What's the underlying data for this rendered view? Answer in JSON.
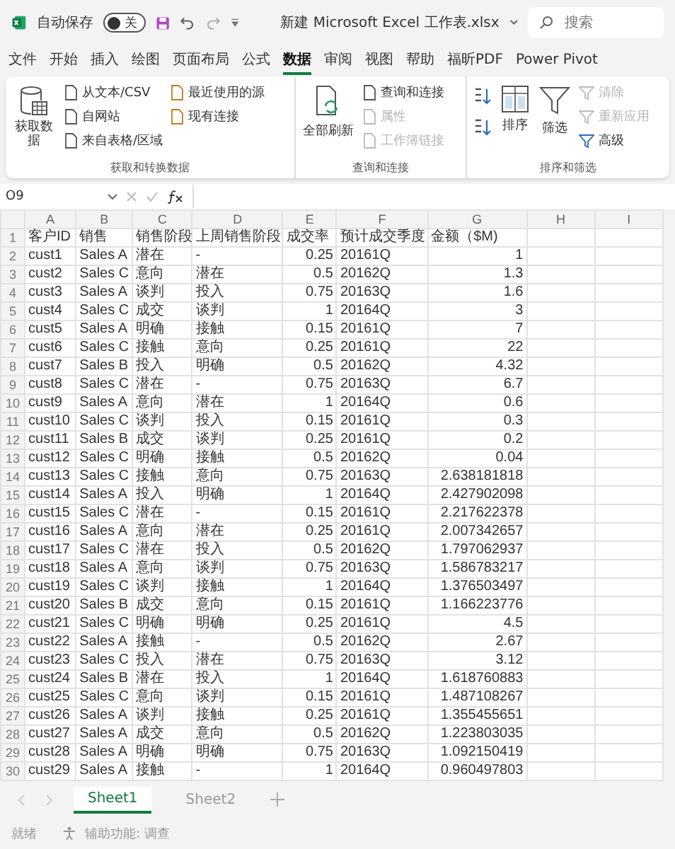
{
  "title_bar": {
    "autosave": {
      "label": "自动保存",
      "on": false,
      "state_text": "关"
    },
    "title": "新建 Microsoft Excel 工作表.xlsx",
    "search": {
      "placeholder": "搜索"
    }
  },
  "tabs": [
    {
      "label": "文件",
      "selected": false
    },
    {
      "label": "开始",
      "selected": false
    },
    {
      "label": "插入",
      "selected": false
    },
    {
      "label": "绘图",
      "selected": false
    },
    {
      "label": "页面布局",
      "selected": false
    },
    {
      "label": "公式",
      "selected": false
    },
    {
      "label": "数据",
      "selected": true
    },
    {
      "label": "审阅",
      "selected": false
    },
    {
      "label": "视图",
      "selected": false
    },
    {
      "label": "帮助",
      "selected": false
    },
    {
      "label": "福昕PDF",
      "selected": false
    },
    {
      "label": "Power Pivot",
      "selected": false
    }
  ],
  "ribbon": {
    "get_transform": {
      "label": "获取和转换数据",
      "get_data": "获取数据",
      "column_1": [
        "从文本/CSV",
        "自网站",
        "来自表格/区域"
      ],
      "column_2": [
        "最近使用的源",
        "现有连接"
      ]
    },
    "queries": {
      "label": "查询和连接",
      "refresh_all": "全部刷新",
      "items": [
        {
          "label": "查询和连接",
          "disabled": false
        },
        {
          "label": "属性",
          "disabled": true
        },
        {
          "label": "工作簿链接",
          "disabled": true
        }
      ]
    },
    "sort_filter": {
      "label": "排序和筛选",
      "sort": "排序",
      "filter": "筛选",
      "items": [
        {
          "label": "清除",
          "disabled": true
        },
        {
          "label": "重新应用",
          "disabled": true
        },
        {
          "label": "高级",
          "disabled": false
        }
      ]
    }
  },
  "formula_bar": {
    "name_box": "O9"
  },
  "columns": [
    "A",
    "B",
    "C",
    "D",
    "E",
    "F",
    "G",
    "H",
    "I"
  ],
  "rows": [
    {
      "num": "1",
      "cells": [
        "客户ID",
        "销售",
        "销售阶段",
        "上周销售阶段",
        "成交率",
        "预计成交季度",
        "金额（$M)"
      ]
    },
    {
      "num": "2",
      "cells": [
        "cust1",
        "Sales A",
        "潜在",
        "-",
        "0.25",
        "20161Q",
        "1"
      ]
    },
    {
      "num": "3",
      "cells": [
        "cust2",
        "Sales C",
        "意向",
        "潜在",
        "0.5",
        "20162Q",
        "1.3"
      ]
    },
    {
      "num": "4",
      "cells": [
        "cust3",
        "Sales A",
        "谈判",
        "投入",
        "0.75",
        "20163Q",
        "1.6"
      ]
    },
    {
      "num": "5",
      "cells": [
        "cust4",
        "Sales C",
        "成交",
        "谈判",
        "1",
        "20164Q",
        "3"
      ]
    },
    {
      "num": "6",
      "cells": [
        "cust5",
        "Sales A",
        "明确",
        "接触",
        "0.15",
        "20161Q",
        "7"
      ]
    },
    {
      "num": "7",
      "cells": [
        "cust6",
        "Sales C",
        "接触",
        "意向",
        "0.25",
        "20161Q",
        "22"
      ]
    },
    {
      "num": "8",
      "cells": [
        "cust7",
        "Sales B",
        "投入",
        "明确",
        "0.5",
        "20162Q",
        "4.32"
      ]
    },
    {
      "num": "9",
      "cells": [
        "cust8",
        "Sales C",
        "潜在",
        "-",
        "0.75",
        "20163Q",
        "6.7"
      ]
    },
    {
      "num": "10",
      "cells": [
        "cust9",
        "Sales A",
        "意向",
        "潜在",
        "1",
        "20164Q",
        "0.6"
      ]
    },
    {
      "num": "11",
      "cells": [
        "cust10",
        "Sales C",
        "谈判",
        "投入",
        "0.15",
        "20161Q",
        "0.3"
      ]
    },
    {
      "num": "12",
      "cells": [
        "cust11",
        "Sales B",
        "成交",
        "谈判",
        "0.25",
        "20161Q",
        "0.2"
      ]
    },
    {
      "num": "13",
      "cells": [
        "cust12",
        "Sales C",
        "明确",
        "接触",
        "0.5",
        "20162Q",
        "0.04"
      ]
    },
    {
      "num": "14",
      "cells": [
        "cust13",
        "Sales C",
        "接触",
        "意向",
        "0.75",
        "20163Q",
        "2.638181818"
      ]
    },
    {
      "num": "15",
      "cells": [
        "cust14",
        "Sales A",
        "投入",
        "明确",
        "1",
        "20164Q",
        "2.427902098"
      ]
    },
    {
      "num": "16",
      "cells": [
        "cust15",
        "Sales C",
        "潜在",
        "-",
        "0.15",
        "20161Q",
        "2.217622378"
      ]
    },
    {
      "num": "17",
      "cells": [
        "cust16",
        "Sales A",
        "意向",
        "潜在",
        "0.25",
        "20161Q",
        "2.007342657"
      ]
    },
    {
      "num": "18",
      "cells": [
        "cust17",
        "Sales C",
        "潜在",
        "投入",
        "0.5",
        "20162Q",
        "1.797062937"
      ]
    },
    {
      "num": "19",
      "cells": [
        "cust18",
        "Sales A",
        "意向",
        "谈判",
        "0.75",
        "20163Q",
        "1.586783217"
      ]
    },
    {
      "num": "20",
      "cells": [
        "cust19",
        "Sales C",
        "谈判",
        "接触",
        "1",
        "20164Q",
        "1.376503497"
      ]
    },
    {
      "num": "21",
      "cells": [
        "cust20",
        "Sales B",
        "成交",
        "意向",
        "0.15",
        "20161Q",
        "1.166223776"
      ]
    },
    {
      "num": "22",
      "cells": [
        "cust21",
        "Sales C",
        "明确",
        "明确",
        "0.25",
        "20161Q",
        "4.5"
      ]
    },
    {
      "num": "23",
      "cells": [
        "cust22",
        "Sales A",
        "接触",
        "-",
        "0.5",
        "20162Q",
        "2.67"
      ]
    },
    {
      "num": "24",
      "cells": [
        "cust23",
        "Sales C",
        "投入",
        "潜在",
        "0.75",
        "20163Q",
        "3.12"
      ]
    },
    {
      "num": "25",
      "cells": [
        "cust24",
        "Sales B",
        "潜在",
        "投入",
        "1",
        "20164Q",
        "1.618760883"
      ]
    },
    {
      "num": "26",
      "cells": [
        "cust25",
        "Sales C",
        "意向",
        "谈判",
        "0.15",
        "20161Q",
        "1.487108267"
      ]
    },
    {
      "num": "27",
      "cells": [
        "cust26",
        "Sales A",
        "谈判",
        "接触",
        "0.25",
        "20161Q",
        "1.355455651"
      ]
    },
    {
      "num": "28",
      "cells": [
        "cust27",
        "Sales A",
        "成交",
        "意向",
        "0.5",
        "20162Q",
        "1.223803035"
      ]
    },
    {
      "num": "29",
      "cells": [
        "cust28",
        "Sales A",
        "明确",
        "明确",
        "0.75",
        "20163Q",
        "1.092150419"
      ]
    },
    {
      "num": "30",
      "cells": [
        "cust29",
        "Sales A",
        "接触",
        "-",
        "1",
        "20164Q",
        "0.960497803"
      ]
    }
  ],
  "sheet_tabs": [
    {
      "label": "Sheet1",
      "selected": true
    },
    {
      "label": "Sheet2",
      "selected": false
    }
  ],
  "status_bar": {
    "ready": "就绪",
    "accessibility": "辅助功能: 调查"
  }
}
